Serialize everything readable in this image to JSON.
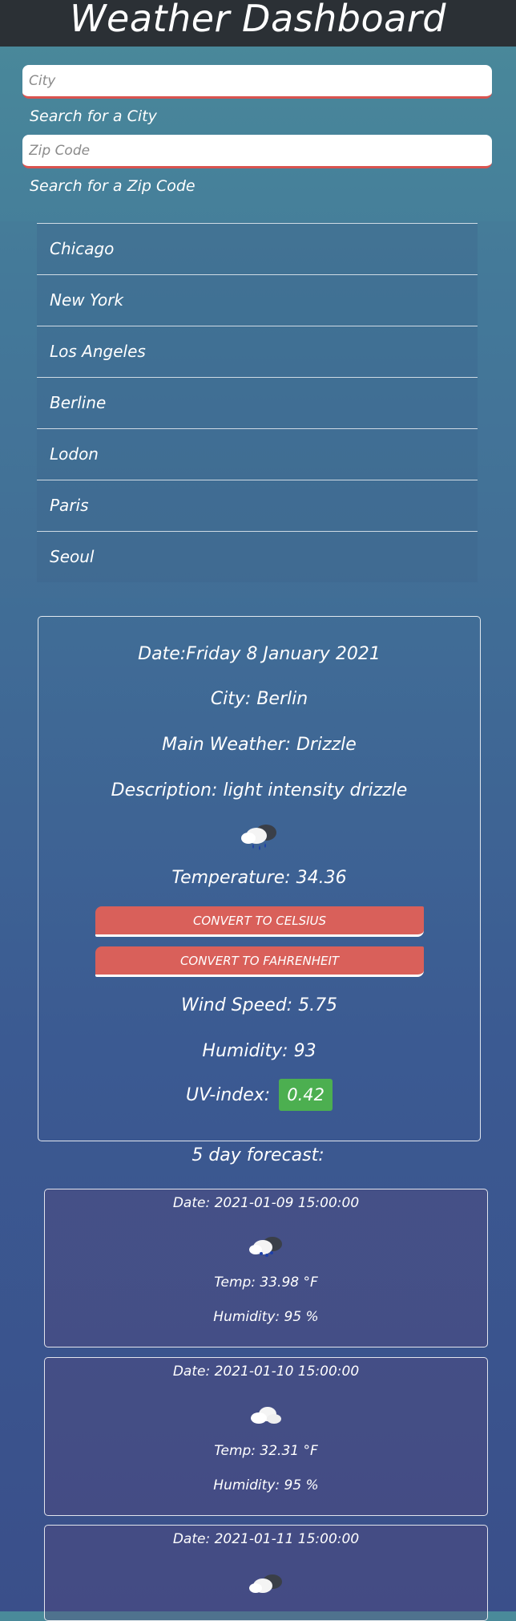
{
  "header": {
    "title": "Weather Dashboard"
  },
  "search": {
    "city_placeholder": "City",
    "city_label": "Search for a City",
    "zip_placeholder": "Zip Code",
    "zip_label": "Search for a Zip Code"
  },
  "cities": [
    {
      "label": "Chicago"
    },
    {
      "label": "New York"
    },
    {
      "label": "Los Angeles"
    },
    {
      "label": "Berline"
    },
    {
      "label": "Lodon"
    },
    {
      "label": "Paris"
    },
    {
      "label": "Seoul"
    }
  ],
  "current": {
    "date": "Date:Friday 8 January 2021",
    "city": "City: Berlin",
    "main_weather": "Main Weather: Drizzle",
    "description": "Description: light intensity drizzle",
    "icon": "drizzle-cloud-icon",
    "temperature": "Temperature: 34.36",
    "celsius_button": "Convert to celsius",
    "fahrenheit_button": "Convert to fahrenheit",
    "wind": "Wind Speed: 5.75",
    "humidity": "Humidity: 93",
    "uv_label": "UV-index:",
    "uv_value": "0.42",
    "uv_color": "#4caf50"
  },
  "forecast": {
    "title": "5 day forecast:",
    "days": [
      {
        "date": "Date: 2021-01-09 15:00:00",
        "icon": "rain-snow-cloud-icon",
        "temp": "Temp: 33.98 °F",
        "humidity": "Humidity: 95 %"
      },
      {
        "date": "Date: 2021-01-10 15:00:00",
        "icon": "cloud-icon",
        "temp": "Temp: 32.31 °F",
        "humidity": "Humidity: 95 %"
      },
      {
        "date": "Date: 2021-01-11 15:00:00",
        "icon": "dark-cloud-icon",
        "temp": "",
        "humidity": ""
      }
    ]
  },
  "colors": {
    "header_bg": "#2b3035",
    "accent_red": "#d9534f",
    "uv_green": "#4caf50"
  }
}
